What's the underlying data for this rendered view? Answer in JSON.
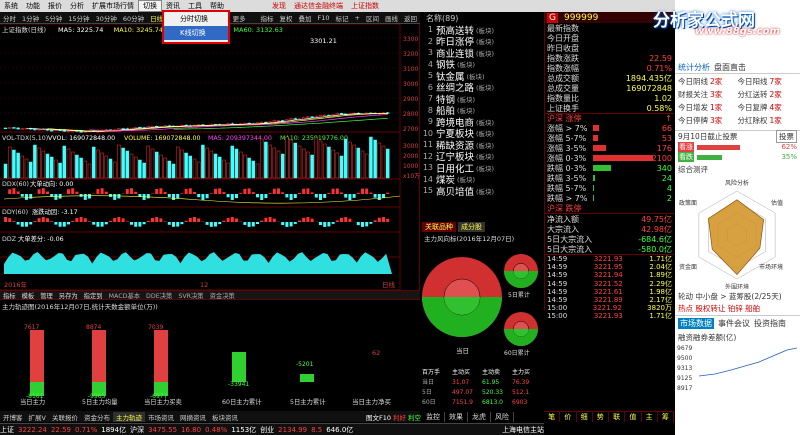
{
  "menu": {
    "items": [
      "系统",
      "功能",
      "报价",
      "分析",
      "扩展市场行情",
      "切换",
      "资讯",
      "工具",
      "帮助"
    ],
    "active": "切换",
    "alerts": [
      "发现",
      "通达信金融终端",
      "上证指数"
    ]
  },
  "popup": {
    "items": [
      "分时切换",
      "K线切换"
    ],
    "hover_index": 1
  },
  "toolbar": {
    "items": [
      "分时",
      "1分钟",
      "5分钟",
      "15分钟",
      "30分钟",
      "60分钟",
      "日线",
      "周线",
      "月线",
      "多周期",
      "更多"
    ],
    "items_right": [
      "指标",
      "复权",
      "叠加",
      "F10",
      "标记",
      "+",
      "区间",
      "画线",
      "返回"
    ]
  },
  "chart": {
    "title": "上证指数(日线)",
    "ma_labels": [
      {
        "text": "MA5: 3225.74",
        "color": "#ffffff"
      },
      {
        "text": "MA10: 3245.74",
        "color": "#ffff40"
      },
      {
        "text": "MA20: 3227.17",
        "color": "#ff40ff"
      },
      {
        "text": "MA60: 3132.63",
        "color": "#40ff40"
      }
    ],
    "peak_label": "3301.21",
    "low_label": "2638.30",
    "y_ticks": [
      "3300",
      "3200",
      "3100",
      "3000",
      "2900",
      "2800",
      "2700"
    ],
    "vol_title": "VOL-TDX(5,10)",
    "vol_values": [
      {
        "text": "VVOL: 169072848.00",
        "color": "#ffffff"
      },
      {
        "text": "VOLUME: 169072848.00",
        "color": "#ffff40"
      },
      {
        "text": "MA5: 209397344.00",
        "color": "#ff40ff"
      },
      {
        "text": "MA10: 235919776.00",
        "color": "#40ff40"
      }
    ],
    "vol_ticks": [
      "3000",
      "2000",
      "1000",
      "x10万"
    ],
    "ddx_title": "DDX(60)",
    "ddx_value": "大单动向: 0.00",
    "ddy_title": "DDY(60)",
    "ddy_value": "涨跌动因: -3.17",
    "ddz_title": "DDZ",
    "ddz_value": "大单差分: -0.06",
    "x_labels": [
      "2016年",
      "12",
      "日线"
    ],
    "sub_tabs": [
      "指标",
      "模板",
      "管理",
      "另存为",
      "指定到",
      "MACD基本",
      "DDE决策",
      "SVR决策",
      "资金决策"
    ]
  },
  "flow": {
    "title": "主力轨迹图(2016年12月07日,统计天数金额单位(万))",
    "bars": [
      {
        "label": "当日主力",
        "top": "7617",
        "bottom": "-8161"
      },
      {
        "label": "5日主力均量",
        "top": "8874",
        "bottom": "-9965"
      },
      {
        "label": "当日主力买卖",
        "top": "7039",
        "bottom": "-6977"
      },
      {
        "label": "60日主力累计",
        "top": "",
        "bottom": "-33941"
      },
      {
        "label": "5日主力累计",
        "top": "",
        "bottom": "-5201"
      },
      {
        "label": "当日主力净买",
        "top": "62",
        "bottom": ""
      }
    ],
    "tabs": [
      "开博客",
      "扩展V",
      "关联报价",
      "资金分布",
      "主力轨迹",
      "市场资讯",
      "网摘资讯",
      "板块资讯"
    ]
  },
  "quote_list": {
    "header": "名称(89)",
    "rows": [
      {
        "n": "1",
        "name": "预高送转",
        "tag": "(板块)"
      },
      {
        "n": "2",
        "name": "昨日涨停",
        "tag": "(板块)"
      },
      {
        "n": "3",
        "name": "商业连锁",
        "tag": "(板块)"
      },
      {
        "n": "4",
        "name": "钢铁",
        "tag": "(板块)"
      },
      {
        "n": "5",
        "name": "钛金属",
        "tag": "(板块)"
      },
      {
        "n": "6",
        "name": "丝绸之路",
        "tag": "(板块)"
      },
      {
        "n": "7",
        "name": "特钢",
        "tag": "(板块)"
      },
      {
        "n": "8",
        "name": "船舶",
        "tag": "(板块)"
      },
      {
        "n": "9",
        "name": "跨境电商",
        "tag": "(板块)"
      },
      {
        "n": "10",
        "name": "宁夏板块",
        "tag": "(板块)"
      },
      {
        "n": "11",
        "name": "稀缺资源",
        "tag": "(板块)"
      },
      {
        "n": "12",
        "name": "辽宁板块",
        "tag": "(板块)"
      },
      {
        "n": "13",
        "name": "日用化工",
        "tag": "(板块)"
      },
      {
        "n": "14",
        "name": "煤炭",
        "tag": "(板块)"
      },
      {
        "n": "15",
        "name": "高贝培值",
        "tag": "(板块)"
      }
    ],
    "tabs": [
      "关联品种",
      "成分股"
    ]
  },
  "pie": {
    "title": "主力风向标(2016年12月07日)",
    "labels": [
      "当日",
      "5日累计",
      "60日累计"
    ]
  },
  "detail": {
    "code": "999999",
    "rows1": [
      {
        "l": "最新指数",
        "v": "",
        "c": ""
      },
      {
        "l": "今日开盘",
        "v": "",
        "c": ""
      },
      {
        "l": "昨日收盘",
        "v": "",
        "c": ""
      },
      {
        "l": "指数涨跌",
        "v": "22.59",
        "c": "red"
      },
      {
        "l": "指数涨幅",
        "v": "0.71%",
        "c": "red"
      },
      {
        "l": "总成交额",
        "v": "1894.435亿",
        "c": ""
      },
      {
        "l": "总成交量",
        "v": "169072848",
        "c": ""
      },
      {
        "l": "指数量比",
        "v": "1.02",
        "c": ""
      },
      {
        "l": "上证换手",
        "v": "0.58%",
        "c": ""
      }
    ],
    "rise_title": "沪深 涨停",
    "rise_rows": [
      {
        "l": "涨幅 > 7%",
        "v": "66",
        "w": 10
      },
      {
        "l": "涨幅 5-7%",
        "v": "53",
        "w": 8
      },
      {
        "l": "涨幅 3-5%",
        "v": "176",
        "w": 22
      },
      {
        "l": "涨幅 0-3%",
        "v": "2100",
        "w": 100
      },
      {
        "l": "跌幅 0-3%",
        "v": "340",
        "w": 30
      },
      {
        "l": "跌幅 3-5%",
        "v": "24",
        "w": 4
      },
      {
        "l": "跌幅 5-7%",
        "v": "4",
        "w": 2
      },
      {
        "l": "跌幅 > 7%",
        "v": "2",
        "w": 1
      }
    ],
    "fall_title": "沪深 跌停",
    "fund": [
      {
        "l": "净流入额",
        "v": "49.75亿",
        "c": "red"
      },
      {
        "l": "大宗流入",
        "v": "42.98亿",
        "c": "red"
      },
      {
        "l": "5日大宗流入",
        "v": "-684.6亿",
        "c": "grn"
      },
      {
        "l": "5日大宗流入",
        "v": "-580.0亿",
        "c": "grn"
      }
    ],
    "ticks": [
      {
        "t": "14:59",
        "p": "3221.93",
        "v": "1.71亿"
      },
      {
        "t": "14:59",
        "p": "3221.95",
        "v": "2.04亿"
      },
      {
        "t": "14:59",
        "p": "3221.94",
        "v": "1.89亿"
      },
      {
        "t": "14:59",
        "p": "3221.52",
        "v": "2.29亿"
      },
      {
        "t": "14:59",
        "p": "3221.61",
        "v": "1.98亿"
      },
      {
        "t": "14:59",
        "p": "3221.89",
        "v": "2.17亿"
      },
      {
        "t": "15:00",
        "p": "3221.92",
        "v": "3820万"
      },
      {
        "t": "15:00",
        "p": "3221.93",
        "v": "1.71亿"
      }
    ],
    "bottom_tabs": [
      "笔",
      "价",
      "细",
      "势",
      "联",
      "值",
      "主",
      "筹"
    ]
  },
  "right_panel": {
    "logo": "分析家公式网",
    "logo_url": "www.88gs.com",
    "header_tabs": [
      "统计分析",
      "盘面直击"
    ],
    "stats": [
      {
        "l": "今日阴线",
        "v": "2家"
      },
      {
        "l": "今日阳线",
        "v": "7家"
      },
      {
        "l": "财报关注",
        "v": "3家"
      },
      {
        "l": "分红送转",
        "v": "2家"
      },
      {
        "l": "今日增发",
        "v": "1家"
      },
      {
        "l": "今日复牌",
        "v": "4家"
      },
      {
        "l": "今日停牌",
        "v": "3家"
      },
      {
        "l": "分红除权",
        "v": "1家"
      }
    ],
    "date_title": "9月10日截止投票",
    "vote_label": "投票",
    "vote": [
      {
        "l": "看涨",
        "v": "62%",
        "c": "#e04040"
      },
      {
        "l": "看跌",
        "v": "35%",
        "c": "#40b040"
      }
    ],
    "radar_title": "综合测评",
    "radar_labels": [
      "风险分析",
      "估值",
      "市场环境",
      "外围环境",
      "资金面",
      "政策面"
    ],
    "news1": "轮动 中小盘 > 蓝筹股(2/25天)",
    "news2": "热点 股权转让 铂锌 船舶",
    "sub_tabs": [
      "市场数据",
      "事件会议",
      "投资指南"
    ],
    "margin_title": "融资融券差额(亿)",
    "margin_ticks": [
      "9679",
      "9500",
      "9313",
      "9125",
      "8917"
    ]
  },
  "statusbar": {
    "items": [
      {
        "t": "上证",
        "c": "#fff"
      },
      {
        "t": "3222.24",
        "c": "#ff4040"
      },
      {
        "t": "22.59",
        "c": "#ff4040"
      },
      {
        "t": "0.71%",
        "c": "#ff4040"
      },
      {
        "t": "1894亿",
        "c": "#fff"
      },
      {
        "t": "沪深",
        "c": "#fff"
      },
      {
        "t": "3475.55",
        "c": "#ff4040"
      },
      {
        "t": "16.80",
        "c": "#ff4040"
      },
      {
        "t": "0.48%",
        "c": "#ff4040"
      },
      {
        "t": "1153亿",
        "c": "#fff"
      },
      {
        "t": "创业",
        "c": "#fff"
      },
      {
        "t": "2134.99",
        "c": "#ff4040"
      },
      {
        "t": "8.5",
        "c": "#ff4040"
      },
      {
        "t": "646.0亿",
        "c": "#fff"
      }
    ],
    "bottom_tabs": [
      "监控",
      "效果",
      "龙虎",
      "风险"
    ],
    "link": "上海电信主站",
    "extra": [
      "图文F10",
      "利好",
      "利空"
    ]
  }
}
